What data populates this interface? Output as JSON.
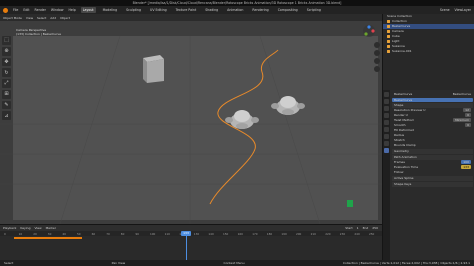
{
  "window": {
    "title": "Blender* [/media/Isa/1/Disk/Cloud/Cloud/Rencana/Blender/Rotoscope Bricks Animation/3D Rotoscope 1 Bricks Animation 3D.blend]"
  },
  "topbar": {
    "menus": [
      "File",
      "Edit",
      "Render",
      "Window",
      "Help"
    ],
    "workspaces": [
      "Layout",
      "Modeling",
      "Sculpting",
      "UV Editing",
      "Texture Paint",
      "Shading",
      "Animation",
      "Rendering",
      "Compositing",
      "Scripting"
    ],
    "active_workspace": "Layout",
    "scene": "Scene",
    "view_layer": "ViewLayer"
  },
  "viewport": {
    "mode": "Object Mode",
    "header_items": [
      "View",
      "Select",
      "Add",
      "Object"
    ],
    "cam_label_line1": "Camera Perspective",
    "cam_label_line2": "(133) Collection | BezierCurve"
  },
  "outliner": {
    "title": "Scene Collection",
    "items": [
      "Collection",
      "BezierCurve",
      "Camera",
      "Cube",
      "Light",
      "Suzanne",
      "Suzanne.001"
    ],
    "selected_index": 1
  },
  "properties": {
    "object_name": "BezierCurve",
    "data_name": "BezierCurve",
    "sections": [
      {
        "label": "Shape"
      },
      {
        "label": "Geometry"
      },
      {
        "label": "Path Animation"
      },
      {
        "label": "Active Spline"
      },
      {
        "label": "Shape Keys"
      }
    ],
    "rows": [
      {
        "label": "Resolution Preview U",
        "value": "12"
      },
      {
        "label": "Render U",
        "value": "0"
      },
      {
        "label": "Twist Method",
        "value": "Minimum"
      },
      {
        "label": "Smooth",
        "value": "0"
      },
      {
        "label": "Fill Deformed",
        "value": ""
      },
      {
        "label": "Radius",
        "value": ""
      },
      {
        "label": "Stretch",
        "value": ""
      },
      {
        "label": "Bounds Clamp",
        "value": ""
      }
    ],
    "path_animation": {
      "frames_label": "Frames",
      "frames_value": "100",
      "eval_label": "Evaluation Time",
      "eval_value": "133",
      "follow_label": "Follow"
    }
  },
  "timeline": {
    "header_items": [
      "Playback",
      "Keying",
      "View",
      "Marker"
    ],
    "current_frame": "133",
    "start_label": "Start",
    "start_value": "1",
    "end_label": "End",
    "end_value": "250",
    "ruler": [
      "0",
      "10",
      "20",
      "30",
      "40",
      "50",
      "60",
      "70",
      "80",
      "90",
      "100",
      "110",
      "120",
      "130",
      "140",
      "150",
      "160",
      "170",
      "180",
      "190",
      "200",
      "210",
      "220",
      "230",
      "240",
      "250"
    ]
  },
  "statusbar": {
    "left": "Select",
    "mid1": "Pan View",
    "mid2": "Context Menu",
    "right": "Collection | BezierCurve | Verts:1,012 | Faces:2,002 | Tris:3,938 | Objects:1/6 | 2.93.1"
  },
  "colors": {
    "accent": "#e87d0d",
    "selection": "#4772b3",
    "playhead": "#4d8ee0"
  }
}
